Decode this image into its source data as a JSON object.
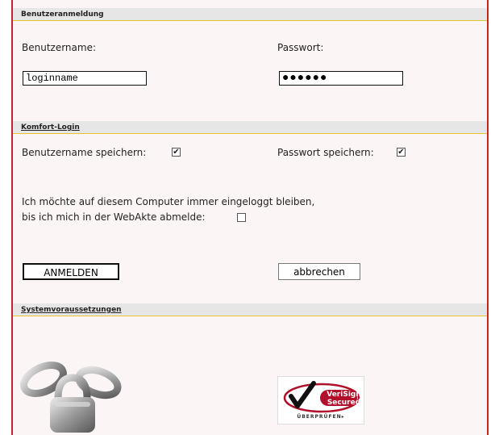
{
  "login_section": {
    "title": "Benutzeranmeldung",
    "username_label": "Benutzername:",
    "password_label": "Passwort:",
    "username_value": "loginname",
    "password_value": "●●●●●●"
  },
  "comfort_section": {
    "title": "Komfort-Login",
    "save_username_label": "Benutzername speichern:",
    "save_password_label": "Passwort speichern:",
    "save_username_checked": true,
    "save_password_checked": true,
    "stay_logged_in_line1": "Ich möchte auf diesem Computer immer eingeloggt bleiben,",
    "stay_logged_in_line2": "bis ich mich in der WebAkte abmelde:",
    "stay_logged_in_checked": false
  },
  "buttons": {
    "login": "ANMELDEN",
    "cancel": "abbrechen"
  },
  "requirements_section": {
    "title": "Systemvoraussetzungen",
    "seal_name": "VeriSign Secured",
    "seal_action": "ÜBERPRÜFEN",
    "lock_icon": "chain-padlock-icon"
  },
  "colors": {
    "frame": "#cc2222",
    "section_rule": "#e8c430",
    "section_bg": "#e6e6e6",
    "panel_bg": "#fbf5f5",
    "verisign_red": "#b0102a"
  }
}
